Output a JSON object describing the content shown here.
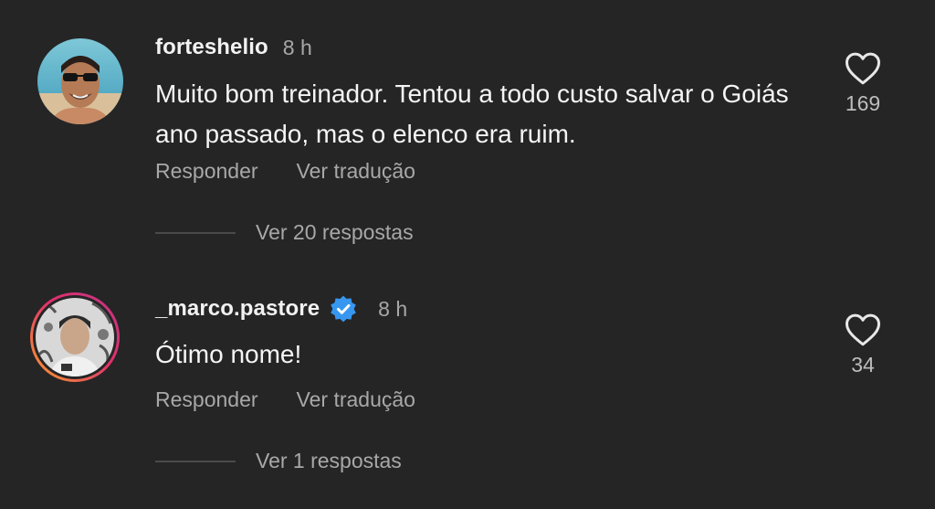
{
  "comments": [
    {
      "username": "forteshelio",
      "time": "8 h",
      "text": "Muito bom treinador. Tentou a todo custo salvar o Goiás  ano passado, mas o elenco era ruim.",
      "reply_label": "Responder",
      "translate_label": "Ver tradução",
      "likes": "169",
      "view_replies": "Ver 20 respostas",
      "verified": false
    },
    {
      "username": "_marco.pastore",
      "time": "8 h",
      "text": "Ótimo nome!",
      "reply_label": "Responder",
      "translate_label": "Ver tradução",
      "likes": "34",
      "view_replies": "Ver 1 respostas",
      "verified": true
    }
  ],
  "colors": {
    "background": "#252525",
    "verified_badge": "#3797f0",
    "story_ring_start": "#f9a12e",
    "story_ring_end": "#c13584"
  },
  "icons": [
    "heart-outline-icon",
    "verified-badge-icon"
  ]
}
